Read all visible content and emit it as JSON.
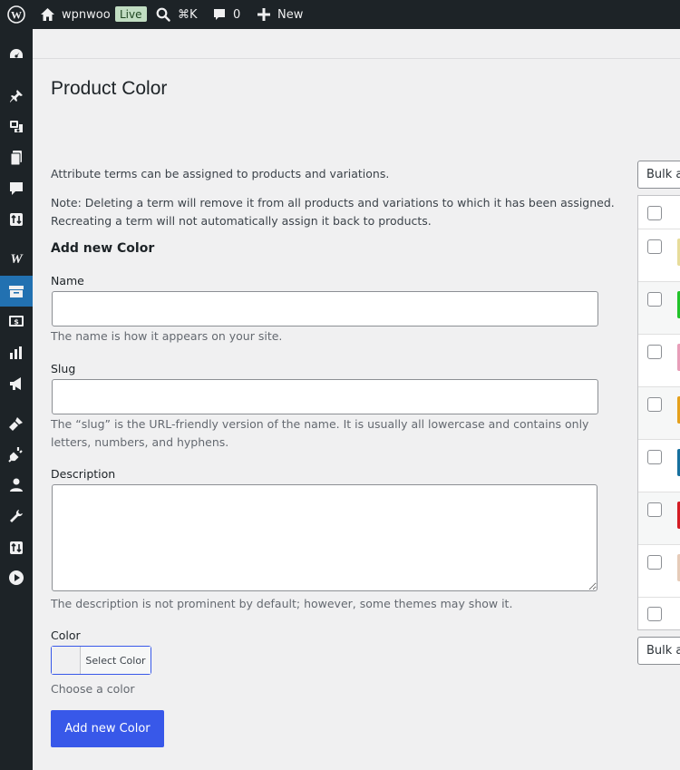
{
  "adminbar": {
    "site_name": "wpnwoo",
    "badge": "Live",
    "shortcut": "⌘K",
    "comments_count": "0",
    "new_label": "New"
  },
  "page": {
    "title": "Product Color"
  },
  "form": {
    "intro": "Attribute terms can be assigned to products and variations.",
    "note_line1": "Note: Deleting a term will remove it from all products and variations to which it has been assigned.",
    "note_line2": "Recreating a term will not automatically assign it back to products.",
    "heading": "Add new Color",
    "name_label": "Name",
    "name_value": "",
    "name_help": "The name is how it appears on your site.",
    "slug_label": "Slug",
    "slug_value": "",
    "slug_help": "The “slug” is the URL-friendly version of the name. It is usually all lowercase and contains only letters, numbers, and hyphens.",
    "description_label": "Description",
    "description_value": "",
    "description_help": "The description is not prominent by default; however, some themes may show it.",
    "color_label": "Color",
    "select_color": "Select Color",
    "color_help": "Choose a color",
    "submit": "Add new Color"
  },
  "terms": {
    "bulk_label": "Bulk actions",
    "swatches": [
      "#e7dc9a",
      "#22c32a",
      "#e99db8",
      "#e5a01c",
      "#17709e",
      "#d41c24",
      "#e6cbb8"
    ]
  }
}
